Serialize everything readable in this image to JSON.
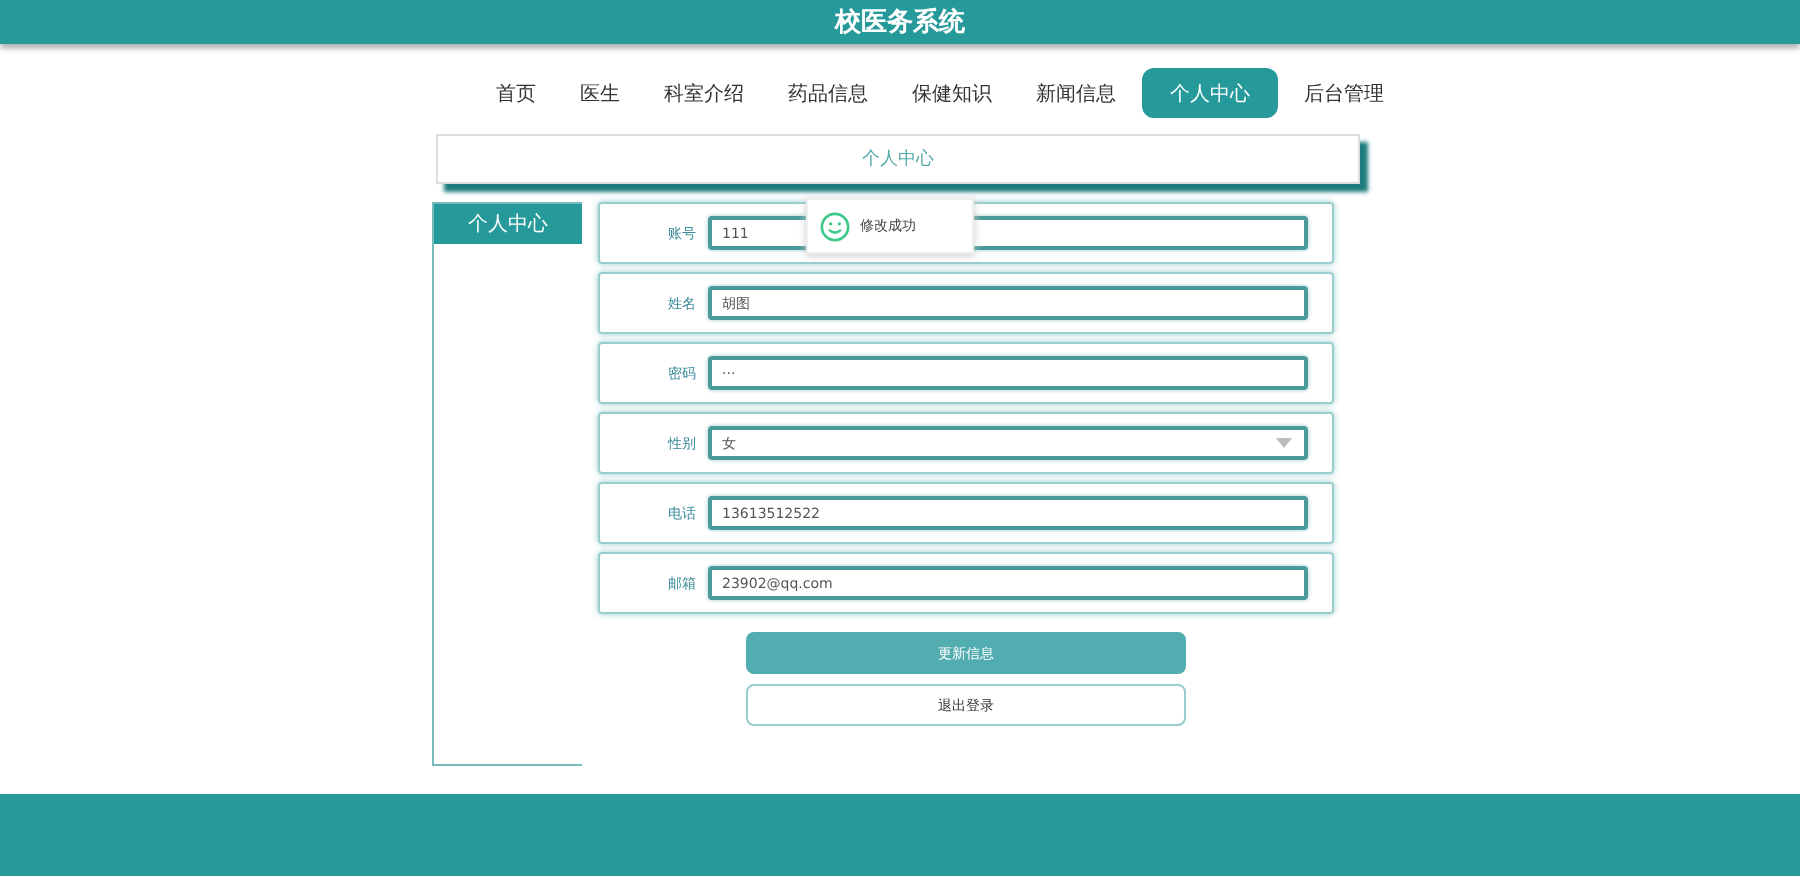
{
  "header": {
    "title": "校医务系统"
  },
  "nav": [
    {
      "label": "首页",
      "selected": false
    },
    {
      "label": "医生",
      "selected": false
    },
    {
      "label": "科室介绍",
      "selected": false
    },
    {
      "label": "药品信息",
      "selected": false
    },
    {
      "label": "保健知识",
      "selected": false
    },
    {
      "label": "新闻信息",
      "selected": false
    },
    {
      "label": "个人中心",
      "selected": true
    },
    {
      "label": "后台管理",
      "selected": false
    }
  ],
  "page_title": "个人中心",
  "sidebar": {
    "items": [
      {
        "label": "个人中心",
        "selected": true
      }
    ]
  },
  "form": {
    "fields": [
      {
        "kind": "input",
        "label": "账号",
        "value": "111"
      },
      {
        "kind": "input",
        "label": "姓名",
        "value": "胡图"
      },
      {
        "kind": "input",
        "label": "密码",
        "value": "···"
      },
      {
        "kind": "select",
        "label": "性别",
        "value": "女"
      },
      {
        "kind": "input",
        "label": "电话",
        "value": "13613512522"
      },
      {
        "kind": "input",
        "label": "邮箱",
        "value": "23902@qq.com"
      }
    ],
    "buttons": [
      {
        "kind": "primary",
        "label": "更新信息"
      },
      {
        "kind": "plain",
        "label": "退出登录"
      }
    ]
  },
  "toast": {
    "message": "修改成功"
  }
}
